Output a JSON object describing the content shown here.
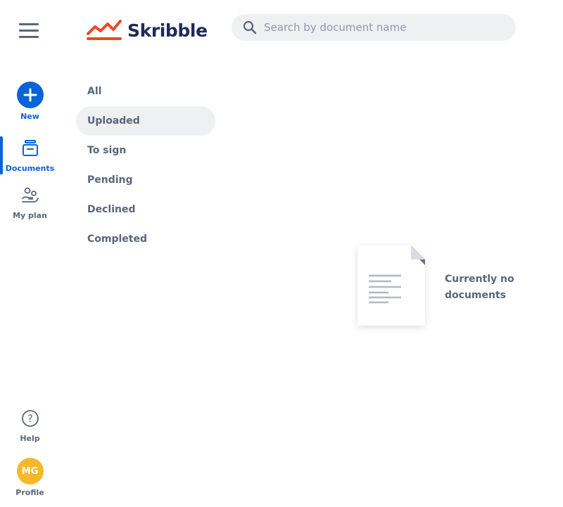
{
  "header": {
    "menu_icon": "hamburger-menu-icon",
    "logo": {
      "text": "Skribble",
      "mark_color": "#ea4a24",
      "text_color": "#1f2a5a"
    },
    "search": {
      "placeholder": "Search by document name",
      "value": "",
      "icon": "search-icon"
    }
  },
  "nav": {
    "new": {
      "label": "New",
      "icon": "plus-icon"
    },
    "documents": {
      "label": "Documents",
      "icon": "inbox-icon",
      "active": true
    },
    "my_plan": {
      "label": "My plan",
      "icon": "plan-icon"
    },
    "help": {
      "label": "Help",
      "icon": "help-icon"
    },
    "profile": {
      "label": "Profile",
      "initials": "MG",
      "avatar_color": "#f6b82a"
    }
  },
  "filters": [
    {
      "label": "All",
      "selected": false
    },
    {
      "label": "Uploaded",
      "selected": true
    },
    {
      "label": "To sign",
      "selected": false
    },
    {
      "label": "Pending",
      "selected": false
    },
    {
      "label": "Declined",
      "selected": false
    },
    {
      "label": "Completed",
      "selected": false
    }
  ],
  "empty_state": {
    "message": "Currently no documents",
    "icon": "empty-document-icon"
  },
  "colors": {
    "accent": "#0a63d8",
    "text": "#5b6479",
    "surface": "#eff0f2"
  }
}
